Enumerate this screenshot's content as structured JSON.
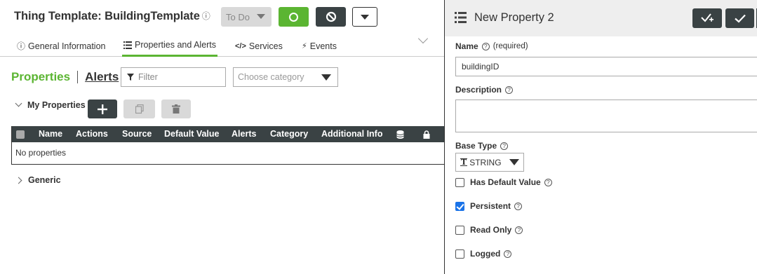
{
  "header": {
    "title": "Thing Template: BuildingTemplate",
    "state_label": "To Do"
  },
  "tabs": [
    {
      "label": "General Information",
      "icon": "info-icon"
    },
    {
      "label": "Properties and Alerts",
      "icon": "list-icon",
      "active": true
    },
    {
      "label": "Services",
      "icon": "code-icon"
    },
    {
      "label": "Events",
      "icon": "lightning-icon"
    }
  ],
  "subnav": {
    "properties": "Properties",
    "alerts": "Alerts",
    "filter_placeholder": "Filter",
    "category_placeholder": "Choose category"
  },
  "groups": {
    "my_properties": "My Properties",
    "generic": "Generic"
  },
  "table": {
    "columns": [
      "Name",
      "Actions",
      "Source",
      "Default Value",
      "Alerts",
      "Category",
      "Additional Info"
    ],
    "empty_text": "No properties"
  },
  "panel": {
    "title": "New Property 2",
    "name_label": "Name",
    "name_required": "(required)",
    "name_value": "buildingID",
    "description_label": "Description",
    "description_value": "",
    "base_type_label": "Base Type",
    "base_type_value": "STRING",
    "checkboxes": [
      {
        "label": "Has Default Value",
        "checked": false
      },
      {
        "label": "Persistent",
        "checked": true
      },
      {
        "label": "Read Only",
        "checked": false
      },
      {
        "label": "Logged",
        "checked": false
      }
    ]
  },
  "colors": {
    "accent_green": "#5bb532",
    "dark_button": "#3a4244",
    "checkbox_blue": "#1a73e8"
  }
}
